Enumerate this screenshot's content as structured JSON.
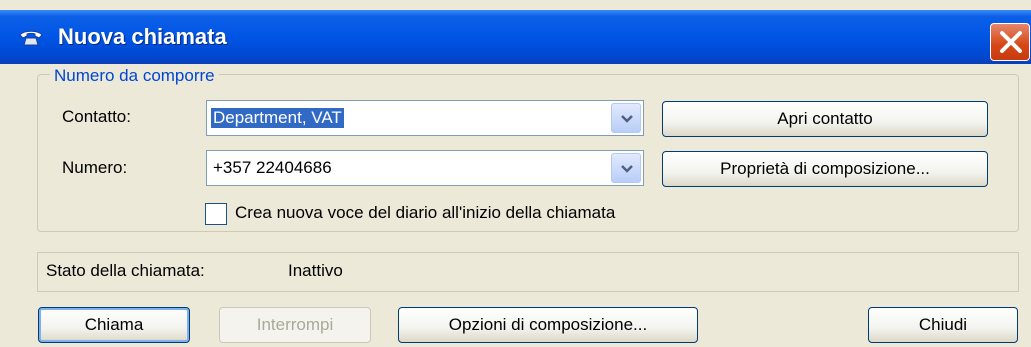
{
  "window": {
    "title": "Nuova chiamata"
  },
  "group": {
    "legend": "Numero da comporre"
  },
  "contact": {
    "label": "Contatto:",
    "value": "Department, VAT",
    "open_button": "Apri contatto"
  },
  "number": {
    "label": "Numero:",
    "value": "+357 22404686",
    "properties_button": "Proprietà di composizione..."
  },
  "journal": {
    "checkbox_label": "Crea nuova voce del diario all'inizio della chiamata",
    "checked": false
  },
  "status": {
    "label": "Stato della chiamata:",
    "value": "Inattivo"
  },
  "buttons": {
    "call": "Chiama",
    "hangup": "Interrompi",
    "dial_options": "Opzioni di composizione...",
    "close": "Chiudi"
  },
  "icons": {
    "app": "phone-handset-icon",
    "close": "close-icon",
    "dropdown": "chevron-down-icon"
  },
  "colors": {
    "titlebar": "#0055e5",
    "selection": "#316ac5",
    "legend_text": "#0046d5",
    "close_button": "#d64514"
  }
}
